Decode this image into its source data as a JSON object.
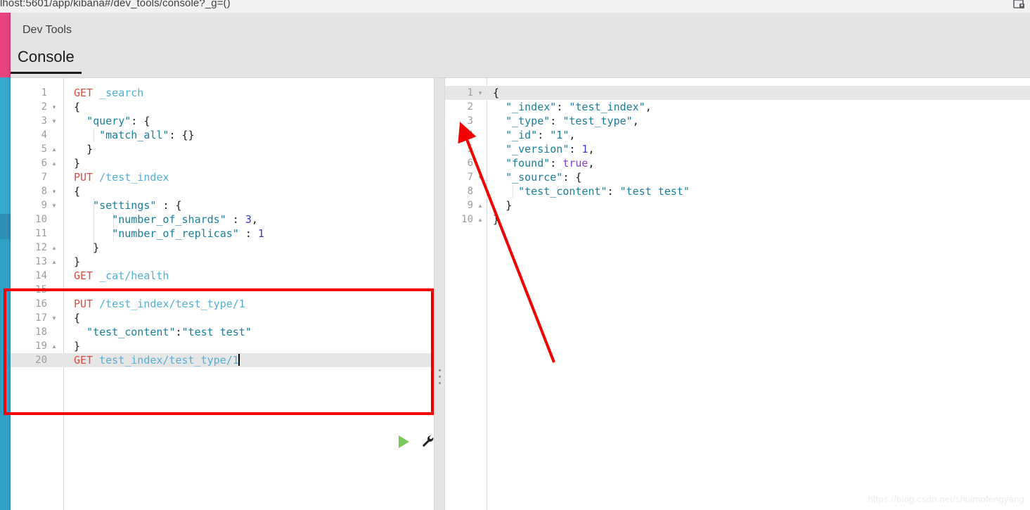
{
  "browser": {
    "url": "lhost:5601/app/kibana#/dev_tools/console?_g=()",
    "extension_icon": "extension-icon"
  },
  "app": {
    "title": "Dev Tools",
    "active_tab": "Console",
    "tabs": [
      "Console"
    ]
  },
  "colors": {
    "rail_pink": "#e7417e",
    "rail_blue": "#37a8d0",
    "rail_blue_dark": "#2e8fb8",
    "header_bg": "#e4e4e4",
    "annotation_red": "#f20000",
    "play_green": "#77c95c",
    "method_red": "#d94f45",
    "url_blue": "#52b0d6",
    "string_teal": "#177f9c",
    "number_blue": "#3939cc",
    "boolean_purple": "#8a3fd1",
    "active_line": "#e6e6e6"
  },
  "request_editor": {
    "name": "console-request-editor",
    "active_line": 20,
    "lines": [
      {
        "n": 1,
        "fold": "",
        "indent": 0,
        "tokens": [
          {
            "t": "method",
            "v": "GET"
          },
          {
            "t": "plain",
            "v": " "
          },
          {
            "t": "url",
            "v": "_search"
          }
        ]
      },
      {
        "n": 2,
        "fold": "▾",
        "indent": 0,
        "tokens": [
          {
            "t": "punct",
            "v": "{"
          }
        ]
      },
      {
        "n": 3,
        "fold": "▾",
        "indent": 0,
        "tokens": [
          {
            "t": "plain",
            "v": "  "
          },
          {
            "t": "key",
            "v": "\"query\""
          },
          {
            "t": "punct",
            "v": ": {"
          }
        ]
      },
      {
        "n": 4,
        "fold": "",
        "indent": 1,
        "tokens": [
          {
            "t": "plain",
            "v": "    "
          },
          {
            "t": "key",
            "v": "\"match_all\""
          },
          {
            "t": "punct",
            "v": ": {}"
          }
        ]
      },
      {
        "n": 5,
        "fold": "▴",
        "indent": 0,
        "tokens": [
          {
            "t": "plain",
            "v": "  "
          },
          {
            "t": "punct",
            "v": "}"
          }
        ]
      },
      {
        "n": 6,
        "fold": "▴",
        "indent": 0,
        "tokens": [
          {
            "t": "punct",
            "v": "}"
          }
        ]
      },
      {
        "n": 7,
        "fold": "",
        "indent": 0,
        "tokens": [
          {
            "t": "method",
            "v": "PUT"
          },
          {
            "t": "plain",
            "v": " "
          },
          {
            "t": "url",
            "v": "/test_index"
          }
        ]
      },
      {
        "n": 8,
        "fold": "▾",
        "indent": 0,
        "tokens": [
          {
            "t": "punct",
            "v": "{"
          }
        ]
      },
      {
        "n": 9,
        "fold": "▾",
        "indent": 1,
        "tokens": [
          {
            "t": "plain",
            "v": "   "
          },
          {
            "t": "key",
            "v": "\"settings\""
          },
          {
            "t": "punct",
            "v": " : {"
          }
        ]
      },
      {
        "n": 10,
        "fold": "",
        "indent": 2,
        "tokens": [
          {
            "t": "plain",
            "v": "      "
          },
          {
            "t": "key",
            "v": "\"number_of_shards\""
          },
          {
            "t": "punct",
            "v": " : "
          },
          {
            "t": "num",
            "v": "3"
          },
          {
            "t": "punct",
            "v": ","
          }
        ]
      },
      {
        "n": 11,
        "fold": "",
        "indent": 2,
        "tokens": [
          {
            "t": "plain",
            "v": "      "
          },
          {
            "t": "key",
            "v": "\"number_of_replicas\""
          },
          {
            "t": "punct",
            "v": " : "
          },
          {
            "t": "num",
            "v": "1"
          }
        ]
      },
      {
        "n": 12,
        "fold": "▴",
        "indent": 1,
        "tokens": [
          {
            "t": "plain",
            "v": "   "
          },
          {
            "t": "punct",
            "v": "}"
          }
        ]
      },
      {
        "n": 13,
        "fold": "▴",
        "indent": 0,
        "tokens": [
          {
            "t": "punct",
            "v": "}"
          }
        ]
      },
      {
        "n": 14,
        "fold": "",
        "indent": 0,
        "tokens": [
          {
            "t": "method",
            "v": "GET"
          },
          {
            "t": "plain",
            "v": " "
          },
          {
            "t": "url",
            "v": "_cat/health"
          }
        ]
      },
      {
        "n": 15,
        "fold": "",
        "indent": 0,
        "tokens": []
      },
      {
        "n": 16,
        "fold": "",
        "indent": 0,
        "tokens": [
          {
            "t": "method",
            "v": "PUT"
          },
          {
            "t": "plain",
            "v": " "
          },
          {
            "t": "url",
            "v": "/test_index/test_type/1"
          }
        ]
      },
      {
        "n": 17,
        "fold": "▾",
        "indent": 0,
        "tokens": [
          {
            "t": "punct",
            "v": "{"
          }
        ]
      },
      {
        "n": 18,
        "fold": "",
        "indent": 0,
        "tokens": [
          {
            "t": "plain",
            "v": "  "
          },
          {
            "t": "key",
            "v": "\"test_content\""
          },
          {
            "t": "punct",
            "v": ":"
          },
          {
            "t": "string",
            "v": "\"test test\""
          }
        ]
      },
      {
        "n": 19,
        "fold": "▴",
        "indent": 0,
        "tokens": [
          {
            "t": "punct",
            "v": "}"
          }
        ]
      },
      {
        "n": 20,
        "fold": "",
        "indent": 0,
        "caret": true,
        "tokens": [
          {
            "t": "method",
            "v": "GET"
          },
          {
            "t": "plain",
            "v": " "
          },
          {
            "t": "url",
            "v": "test_index/test_type/1"
          }
        ]
      }
    ]
  },
  "response_editor": {
    "name": "console-response-viewer",
    "active_line": 1,
    "lines": [
      {
        "n": 1,
        "fold": "▾",
        "indent": 0,
        "tokens": [
          {
            "t": "punct",
            "v": "{"
          }
        ]
      },
      {
        "n": 2,
        "fold": "",
        "indent": 0,
        "tokens": [
          {
            "t": "plain",
            "v": "  "
          },
          {
            "t": "key",
            "v": "\"_index\""
          },
          {
            "t": "punct",
            "v": ": "
          },
          {
            "t": "string",
            "v": "\"test_index\""
          },
          {
            "t": "punct",
            "v": ","
          }
        ]
      },
      {
        "n": 3,
        "fold": "",
        "indent": 0,
        "tokens": [
          {
            "t": "plain",
            "v": "  "
          },
          {
            "t": "key",
            "v": "\"_type\""
          },
          {
            "t": "punct",
            "v": ": "
          },
          {
            "t": "string",
            "v": "\"test_type\""
          },
          {
            "t": "punct",
            "v": ","
          }
        ]
      },
      {
        "n": 4,
        "fold": "",
        "indent": 0,
        "tokens": [
          {
            "t": "plain",
            "v": "  "
          },
          {
            "t": "key",
            "v": "\"_id\""
          },
          {
            "t": "punct",
            "v": ": "
          },
          {
            "t": "string",
            "v": "\"1\""
          },
          {
            "t": "punct",
            "v": ","
          }
        ]
      },
      {
        "n": 5,
        "fold": "",
        "indent": 0,
        "tokens": [
          {
            "t": "plain",
            "v": "  "
          },
          {
            "t": "key",
            "v": "\"_version\""
          },
          {
            "t": "punct",
            "v": ": "
          },
          {
            "t": "num",
            "v": "1"
          },
          {
            "t": "punct",
            "v": ","
          }
        ]
      },
      {
        "n": 6,
        "fold": "",
        "indent": 0,
        "tokens": [
          {
            "t": "plain",
            "v": "  "
          },
          {
            "t": "key",
            "v": "\"found\""
          },
          {
            "t": "punct",
            "v": ": "
          },
          {
            "t": "bool",
            "v": "true"
          },
          {
            "t": "punct",
            "v": ","
          }
        ]
      },
      {
        "n": 7,
        "fold": "▾",
        "indent": 0,
        "tokens": [
          {
            "t": "plain",
            "v": "  "
          },
          {
            "t": "key",
            "v": "\"_source\""
          },
          {
            "t": "punct",
            "v": ": {"
          }
        ]
      },
      {
        "n": 8,
        "fold": "",
        "indent": 1,
        "tokens": [
          {
            "t": "plain",
            "v": "    "
          },
          {
            "t": "key",
            "v": "\"test_content\""
          },
          {
            "t": "punct",
            "v": ": "
          },
          {
            "t": "string",
            "v": "\"test test\""
          }
        ]
      },
      {
        "n": 9,
        "fold": "▴",
        "indent": 0,
        "tokens": [
          {
            "t": "plain",
            "v": "  "
          },
          {
            "t": "punct",
            "v": "}"
          }
        ]
      },
      {
        "n": 10,
        "fold": "▴",
        "indent": 0,
        "tokens": [
          {
            "t": "punct",
            "v": "}"
          }
        ]
      }
    ]
  },
  "controls": {
    "play_label": "play-triangle",
    "wrench_label": "wrench-icon",
    "splitter_label": "pane-splitter"
  },
  "annotations": {
    "highlight_box": "red-rectangle-highlight",
    "arrow": "red-arrow"
  },
  "watermark": "https://blog.csdn.net/shuimofengyang"
}
